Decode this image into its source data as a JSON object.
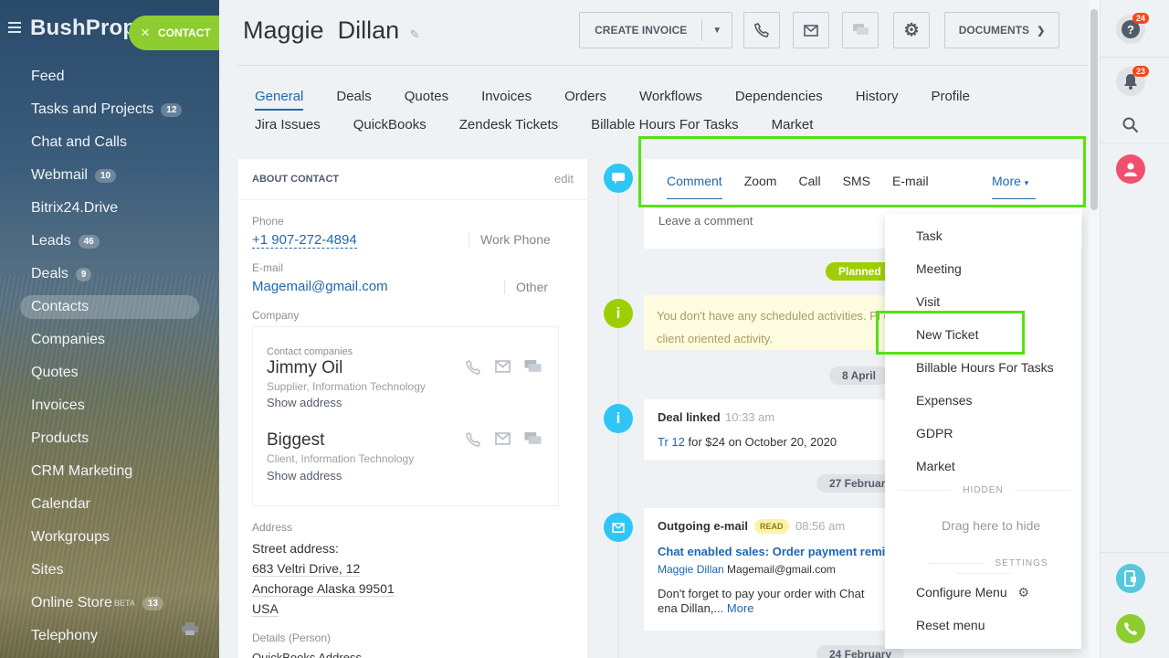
{
  "sidebar": {
    "logo": "BushProp",
    "contact_button": "CONTACT",
    "items": [
      {
        "label": "Feed",
        "badge": ""
      },
      {
        "label": "Tasks and Projects",
        "badge": "12"
      },
      {
        "label": "Chat and Calls",
        "badge": ""
      },
      {
        "label": "Webmail",
        "badge": "10"
      },
      {
        "label": "Bitrix24.Drive",
        "badge": ""
      },
      {
        "label": "Leads",
        "badge": "46"
      },
      {
        "label": "Deals",
        "badge": "9"
      },
      {
        "label": "Contacts",
        "badge": ""
      },
      {
        "label": "Companies",
        "badge": ""
      },
      {
        "label": "Quotes",
        "badge": ""
      },
      {
        "label": "Invoices",
        "badge": ""
      },
      {
        "label": "Products",
        "badge": ""
      },
      {
        "label": "CRM Marketing",
        "badge": ""
      },
      {
        "label": "Calendar",
        "badge": ""
      },
      {
        "label": "Workgroups",
        "badge": ""
      },
      {
        "label": "Sites",
        "badge": ""
      },
      {
        "label": "Online Store",
        "badge": "13",
        "beta": "BETA"
      },
      {
        "label": "Telephony",
        "badge": ""
      }
    ]
  },
  "header": {
    "title_first": "Maggie",
    "title_last": "Dillan",
    "create_invoice": "CREATE INVOICE",
    "documents": "DOCUMENTS"
  },
  "tabs": {
    "row1": [
      "General",
      "Deals",
      "Quotes",
      "Invoices",
      "Orders",
      "Workflows",
      "Dependencies",
      "History",
      "Profile"
    ],
    "row2": [
      "Jira Issues",
      "QuickBooks",
      "Zendesk Tickets",
      "Billable Hours For Tasks",
      "Market"
    ]
  },
  "about": {
    "header": "ABOUT CONTACT",
    "edit": "edit",
    "phone_label": "Phone",
    "phone": "+1 907-272-4894",
    "phone_type": "Work Phone",
    "email_label": "E-mail",
    "email": "Magemail@gmail.com",
    "email_type": "Other",
    "company_label": "Company",
    "contact_companies": "Contact companies",
    "companies": [
      {
        "name": "Jimmy Oil",
        "sub": "Supplier, Information Technology",
        "show": "Show address"
      },
      {
        "name": "Biggest",
        "sub": "Client, Information Technology",
        "show": "Show address"
      }
    ],
    "address_label": "Address",
    "street_label": "Street address:",
    "street": "683 Veltri Drive, 12",
    "city": "Anchorage Alaska 99501",
    "country": "USA",
    "details_label": "Details (Person)",
    "qb_label": "QuickBooks Address"
  },
  "composer": {
    "tabs": [
      "Comment",
      "Zoom",
      "Call",
      "SMS",
      "E-mail"
    ],
    "more": "More",
    "placeholder": "Leave a comment"
  },
  "timeline": {
    "planned": "Planned",
    "warning": "You don't have any scheduled activities. Pl other client oriented activity.",
    "date1": "8 April",
    "deal_title": "Deal linked",
    "deal_time": "10:33 am",
    "deal_link": "Tr 12",
    "deal_text": "for $24 on October 20, 2020",
    "date2": "27 Februar",
    "email_title": "Outgoing e-mail",
    "email_badge": "READ",
    "email_time": "08:56 am",
    "email_subject": "Chat enabled sales: Order payment remi",
    "email_from_name": "Maggie Dillan",
    "email_from_addr": "Magemail@gmail.com",
    "email_body": "Don't forget to pay your order with Chat ena Dillan,...",
    "email_more": "More",
    "date3": "24 February"
  },
  "dropdown": {
    "items": [
      "Task",
      "Meeting",
      "Visit",
      "New Ticket",
      "Billable Hours For Tasks",
      "Expenses",
      "GDPR",
      "Market"
    ],
    "hidden_label": "HIDDEN",
    "drag_hint": "Drag here to hide",
    "settings_label": "SETTINGS",
    "configure": "Configure Menu",
    "reset": "Reset menu"
  },
  "rail": {
    "help_count": "24",
    "notif_count": "23"
  },
  "colors": {
    "accent_green": "#8ecd2f",
    "link_blue": "#2067b0",
    "timeline_blue": "#2fc6f6",
    "highlight": "#54e311"
  }
}
